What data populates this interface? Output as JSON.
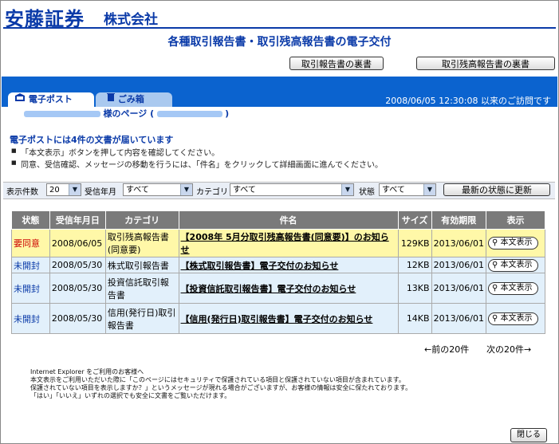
{
  "brand": {
    "name": "安藤証券",
    "suffix": "株式会社"
  },
  "page_title": "各種取引報告書・取引残高報告書の電子交付",
  "top_buttons": {
    "trade_report_back": "取引報告書の裏書",
    "balance_report_back": "取引残高報告書の裏書"
  },
  "tabs": {
    "post": "電子ポスト",
    "trash": "ごみ箱"
  },
  "last_visit": "2008/06/05 12:30:08 以来のご訪問です",
  "user_page": {
    "suffix": "様のページ (",
    "close": ")"
  },
  "notice": "電子ポストには4件の文書が届いています",
  "instructions": [
    "「本文表示」ボタンを押して内容を確認してください。",
    "同意、受信確認、メッセージの移動を行うには、「件名」をクリックして詳細画面に進んでください。"
  ],
  "filters": {
    "count_label": "表示件数",
    "count_value": "20",
    "month_label": "受信年月",
    "month_value": "すべて",
    "category_label": "カテゴリ",
    "category_value": "すべて",
    "status_label": "状態",
    "status_value": "すべて",
    "refresh_label": "最新の状態に更新"
  },
  "table": {
    "headers": [
      "状態",
      "受信年月日",
      "カテゴリ",
      "件名",
      "サイズ",
      "有効期限",
      "表示"
    ],
    "view_label": "本文表示",
    "rows": [
      {
        "status": "要同意",
        "date": "2008/06/05",
        "category": "取引残高報告書(同意要)",
        "subject": "【2008年 5月分取引残高報告書(同意要)】のお知らせ",
        "size": "129KB",
        "expiry": "2013/06/01"
      },
      {
        "status": "未開封",
        "date": "2008/05/30",
        "category": "株式取引報告書",
        "subject": "【株式取引報告書】電子交付のお知らせ",
        "size": "12KB",
        "expiry": "2013/06/01"
      },
      {
        "status": "未開封",
        "date": "2008/05/30",
        "category": "投資信託取引報告書",
        "subject": "【投資信託取引報告書】電子交付のお知らせ",
        "size": "13KB",
        "expiry": "2013/06/01"
      },
      {
        "status": "未開封",
        "date": "2008/05/30",
        "category": "信用(発行日)取引報告書",
        "subject": "【信用(発行日)取引報告書】電子交付のお知らせ",
        "size": "14KB",
        "expiry": "2013/06/01"
      }
    ]
  },
  "pager": {
    "prev": "←前の20件",
    "next": "次の20件→"
  },
  "footnote": [
    "Internet Explorer をご利用のお客様へ",
    "本文表示をご利用いただいた際に「このページにはセキュリティで保護されている項目と保護されていない項目が含まれています。",
    "保護されていない項目を表示しますか？」というメッセージが現れる場合がございますが、お客様の情報は安全に保たれております。",
    "「はい」「いいえ」いずれの選択でも安全に文書をご覧いただけます。"
  ],
  "close_label": "閉じる",
  "colors": {
    "brand_blue": "#0a3aa8",
    "bar_blue": "#0b63cf",
    "pending_row": "#fff8a8",
    "unread_row": "#e2f0fb",
    "pending_text": "#cc0000"
  },
  "icons": {
    "post": "mailbox-icon",
    "trash": "trash-icon",
    "view": "pin-icon"
  }
}
